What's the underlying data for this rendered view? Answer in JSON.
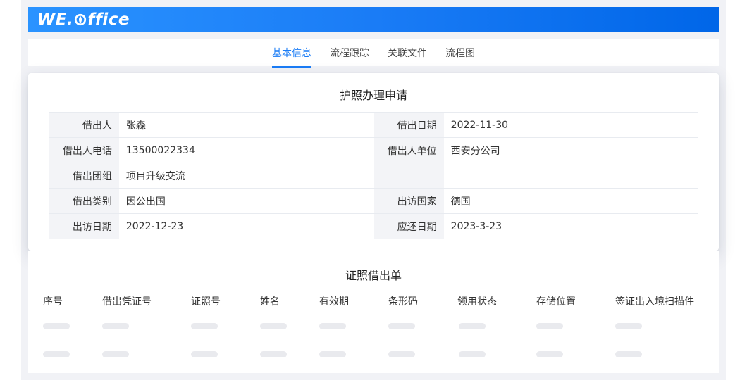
{
  "header": {
    "logo_text_left": "WE.",
    "logo_text_right": "ffice",
    "logo_icon": "leaf-o-icon",
    "gradient": [
      "#2a93ff",
      "#0066e8"
    ]
  },
  "tabs": [
    {
      "label": "基本信息",
      "active": true
    },
    {
      "label": "流程跟踪",
      "active": false
    },
    {
      "label": "关联文件",
      "active": false
    },
    {
      "label": "流程图",
      "active": false
    }
  ],
  "accent_color": "#1a7cf6",
  "form": {
    "title": "护照办理申请",
    "rows": [
      [
        {
          "label": "借出人",
          "value": "张森"
        },
        {
          "label": "借出日期",
          "value": "2022-11-30"
        }
      ],
      [
        {
          "label": "借出人电话",
          "value": "13500022334"
        },
        {
          "label": "借出人单位",
          "value": "西安分公司"
        }
      ],
      [
        {
          "label": "借出团组",
          "value": "项目升级交流"
        },
        {
          "label": "",
          "value": ""
        }
      ],
      [
        {
          "label": "借出类别",
          "value": "因公出国"
        },
        {
          "label": "出访国家",
          "value": "德国"
        }
      ],
      [
        {
          "label": "出访日期",
          "value": "2022-12-23"
        },
        {
          "label": "应还日期",
          "value": "2023-3-23"
        }
      ]
    ]
  },
  "list": {
    "title": "证照借出单",
    "columns": [
      "序号",
      "借出凭证号",
      "证照号",
      "姓名",
      "有效期",
      "条形码",
      "领用状态",
      "存储位置",
      "签证出入境扫描件"
    ],
    "loading_rows": 2
  }
}
